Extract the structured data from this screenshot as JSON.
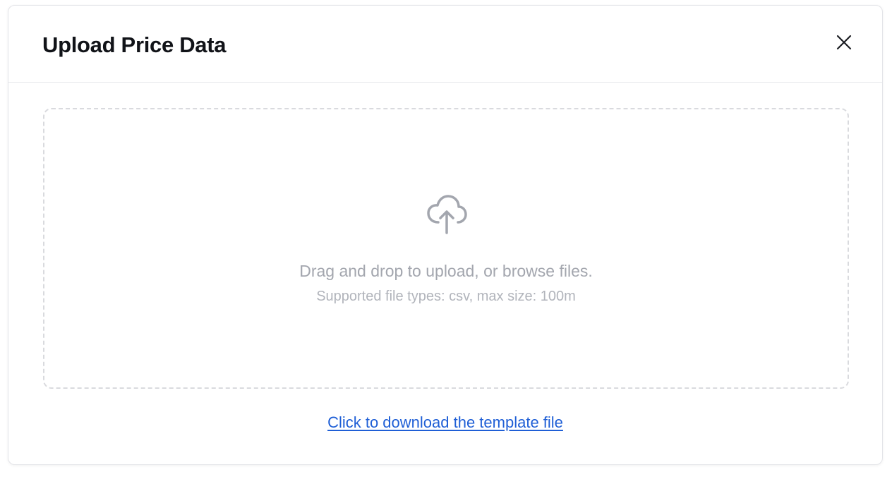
{
  "dialog": {
    "title": "Upload Price Data",
    "close_icon": "close-icon"
  },
  "dropzone": {
    "icon": "cloud-upload-icon",
    "primary_text": "Drag and drop to upload, or browse files.",
    "secondary_text": "Supported file types: csv, max size: 100m"
  },
  "footer": {
    "template_link_label": "Click to download the template file"
  },
  "colors": {
    "title": "#111318",
    "link": "#1f5fd6",
    "muted_text": "#a3a6ae",
    "dashed_border": "#d9dade"
  }
}
